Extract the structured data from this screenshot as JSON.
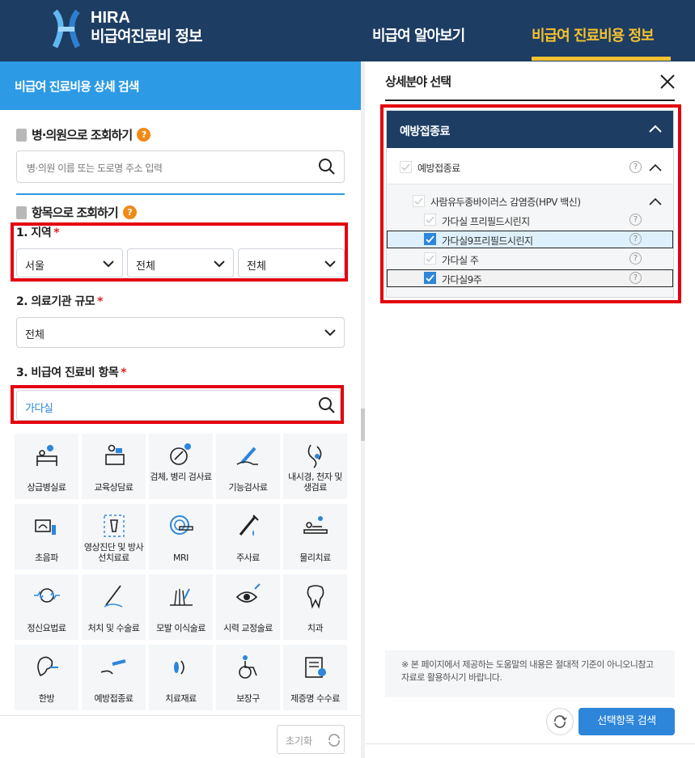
{
  "header": {
    "logo_main": "HIRA",
    "logo_sub": "비급여진료비 정보",
    "nav": [
      {
        "label": "비급여 알아보기"
      },
      {
        "label": "비급여 진료비용 정보"
      }
    ],
    "active_color": "#f5c22f",
    "bg_color": "#1d3d63"
  },
  "left": {
    "title": "비급여 진료비용 상세 검색",
    "hospital_search": {
      "heading": "병·의원으로 조회하기",
      "help": "?",
      "placeholder": "병·의원 이름 또는 도로명 주소 입력"
    },
    "item_search": {
      "heading": "항목으로 조회하기",
      "help": "?"
    },
    "region": {
      "label": "1. 지역",
      "required": "*",
      "selects": [
        "서울",
        "전체",
        "전체"
      ]
    },
    "scale": {
      "label": "2. 의료기관 규모",
      "required": "*",
      "value": "전체"
    },
    "item": {
      "label": "3. 비급여 진료비 항목",
      "required": "*",
      "value": "가다실"
    },
    "categories": [
      {
        "label": "상급병실료",
        "icon": "hospital-bed-icon"
      },
      {
        "label": "교육상담료",
        "icon": "counseling-desk-icon"
      },
      {
        "label": "검체, 병리 검사료",
        "icon": "specimen-test-icon"
      },
      {
        "label": "기능검사료",
        "icon": "thermometer-hand-icon"
      },
      {
        "label": "내시경, 천자 및 생검료",
        "icon": "endoscope-icon"
      },
      {
        "label": "초음파",
        "icon": "ultrasound-icon"
      },
      {
        "label": "영상진단 및 방사선치료료",
        "icon": "xray-icon"
      },
      {
        "label": "MRI",
        "icon": "mri-scanner-icon"
      },
      {
        "label": "주사료",
        "icon": "syringe-icon"
      },
      {
        "label": "물리치료",
        "icon": "physical-therapy-icon"
      },
      {
        "label": "정신요법료",
        "icon": "brain-wave-icon"
      },
      {
        "label": "처치 및 수술료",
        "icon": "scalpel-icon"
      },
      {
        "label": "모발 이식술료",
        "icon": "hair-transplant-icon"
      },
      {
        "label": "시력 교정술료",
        "icon": "eye-laser-icon"
      },
      {
        "label": "치과",
        "icon": "tooth-icon"
      },
      {
        "label": "한방",
        "icon": "acupuncture-ear-icon"
      },
      {
        "label": "예방접종료",
        "icon": "vaccine-arm-icon"
      },
      {
        "label": "치료재료",
        "icon": "treatment-material-icon"
      },
      {
        "label": "보장구",
        "icon": "wheelchair-icon"
      },
      {
        "label": "제증명 수수료",
        "icon": "certificate-icon"
      }
    ],
    "reset_label": "초기화"
  },
  "right": {
    "title": "상세분야 선택",
    "tree_title": "예방접종료",
    "group": {
      "label": "예방접종료"
    },
    "subgroup": {
      "label": "사람유두종바이러스 감염증(HPV 백신)"
    },
    "items": [
      {
        "label": "가다실 프리필드시린지",
        "checked": false
      },
      {
        "label": "가다실9프리필드시린지",
        "checked": true
      },
      {
        "label": "가다실 주",
        "checked": false
      },
      {
        "label": "가다실9주",
        "checked": true
      }
    ],
    "notice": "※ 본 페이지에서 제공하는 도움말의 내용은 절대적 기준이 아니오니참고자료로 활용하시기 바랍니다.",
    "search_button": "선택항목 검색"
  }
}
